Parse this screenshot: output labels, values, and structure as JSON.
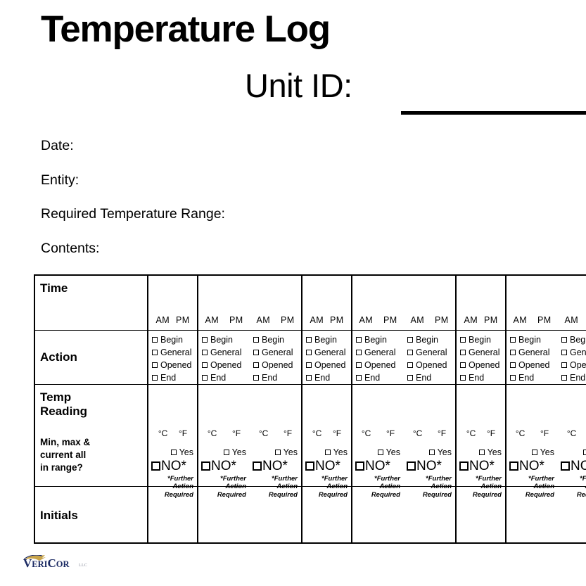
{
  "header": {
    "title": "Temperature Log",
    "unit_id_label": "Unit ID:",
    "unit_id_value": ""
  },
  "form_fields": [
    {
      "label": "Date:",
      "value": ""
    },
    {
      "label": "Entity:",
      "value": ""
    },
    {
      "label": "Required Temperature Range:",
      "value": ""
    },
    {
      "label": "Contents:",
      "value": ""
    }
  ],
  "table": {
    "rows": {
      "time": {
        "label": "Time",
        "am": "AM",
        "pm": "PM"
      },
      "action": {
        "label": "Action",
        "options": [
          "Begin",
          "General",
          "Opened",
          "End"
        ]
      },
      "temp": {
        "label_line1": "Temp",
        "label_line2": "Reading",
        "celsius": "°C",
        "fahrenheit": "°F"
      },
      "range_check": {
        "label_line1": "Min, max &",
        "label_line2": "current all",
        "label_line3": "in range?",
        "yes": "Yes",
        "no": "NO*",
        "note_line1": "*Further Action",
        "note_line2": "Required"
      },
      "initials": {
        "label": "Initials"
      }
    },
    "column_groups": [
      {
        "subcolumns": 1
      },
      {
        "subcolumns": 2
      },
      {
        "subcolumns": 1
      },
      {
        "subcolumns": 2
      },
      {
        "subcolumns": 1
      },
      {
        "subcolumns": 2
      }
    ]
  },
  "footer": {
    "logo_v": "V",
    "logo_eri": "ERI",
    "logo_c": "C",
    "logo_or": "OR",
    "logo_suffix": "LLC"
  },
  "colors": {
    "text": "#000000",
    "rule": "#000000",
    "logo_navy": "#1b2a63",
    "logo_gold": "#c8a44a",
    "background": "#ffffff"
  }
}
